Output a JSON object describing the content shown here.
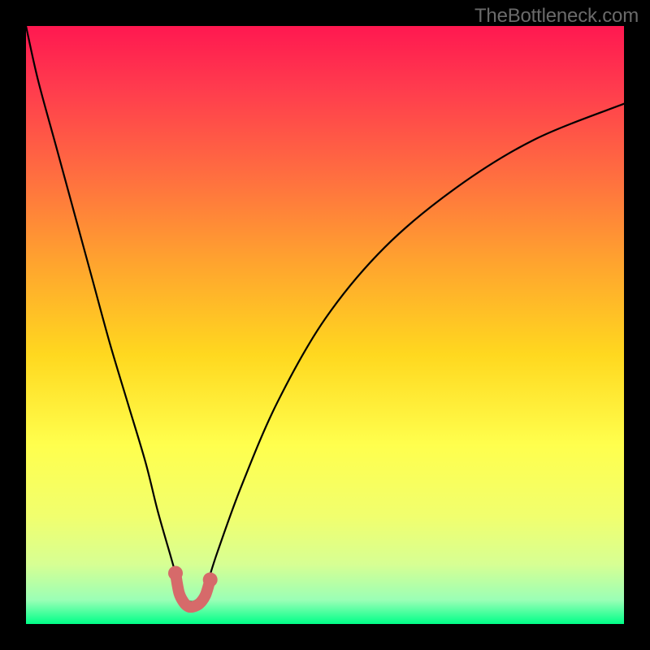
{
  "watermark": "TheBottleneck.com",
  "chart_data": {
    "type": "line",
    "title": "",
    "xlabel": "",
    "ylabel": "",
    "xlim": [
      0,
      100
    ],
    "ylim": [
      0,
      100
    ],
    "series": [
      {
        "name": "bottleneck-curve",
        "x": [
          0,
          2,
          5,
          8,
          11,
          14,
          17,
          20,
          22,
          24,
          25.5,
          27,
          28.5,
          30,
          32,
          36,
          42,
          50,
          60,
          72,
          85,
          100
        ],
        "y": [
          100,
          91,
          80,
          69,
          58,
          47,
          37,
          27,
          19,
          12,
          7,
          4,
          4,
          6,
          12,
          23,
          37,
          51,
          63,
          73,
          81,
          87
        ]
      }
    ],
    "markers": {
      "name": "highlight-band",
      "x": [
        25.0,
        25.6,
        26.4,
        27.2,
        28.0,
        29.0,
        30.0,
        30.8
      ],
      "y": [
        8.5,
        5.2,
        3.6,
        2.9,
        2.9,
        3.4,
        4.8,
        7.4
      ],
      "color": "#d66a6a",
      "size": 14
    },
    "gradient_stops": [
      {
        "pos": 0.0,
        "color": "#ff1850"
      },
      {
        "pos": 0.1,
        "color": "#ff3a4e"
      },
      {
        "pos": 0.25,
        "color": "#ff6e40"
      },
      {
        "pos": 0.4,
        "color": "#ffa52e"
      },
      {
        "pos": 0.55,
        "color": "#ffd81f"
      },
      {
        "pos": 0.7,
        "color": "#ffff4d"
      },
      {
        "pos": 0.82,
        "color": "#f1ff6e"
      },
      {
        "pos": 0.9,
        "color": "#d7ff93"
      },
      {
        "pos": 0.96,
        "color": "#9affb6"
      },
      {
        "pos": 1.0,
        "color": "#00ff88"
      }
    ]
  }
}
